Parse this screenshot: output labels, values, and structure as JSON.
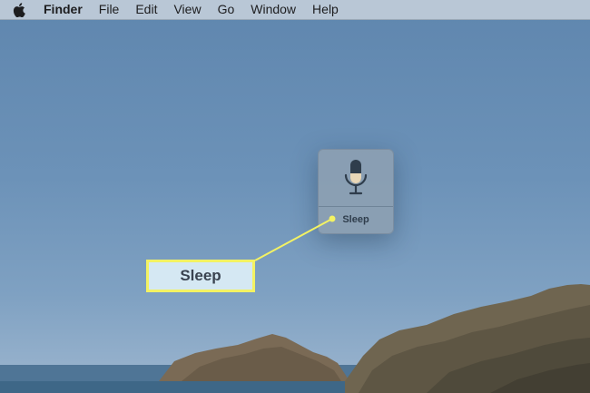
{
  "menubar": {
    "apple_icon": "apple-logo-icon",
    "app_name": "Finder",
    "items": [
      "File",
      "Edit",
      "View",
      "Go",
      "Window",
      "Help"
    ]
  },
  "dictation": {
    "icon": "microphone-icon",
    "status": "Sleep"
  },
  "callout": {
    "label": "Sleep",
    "highlight_color": "#f3f263"
  }
}
